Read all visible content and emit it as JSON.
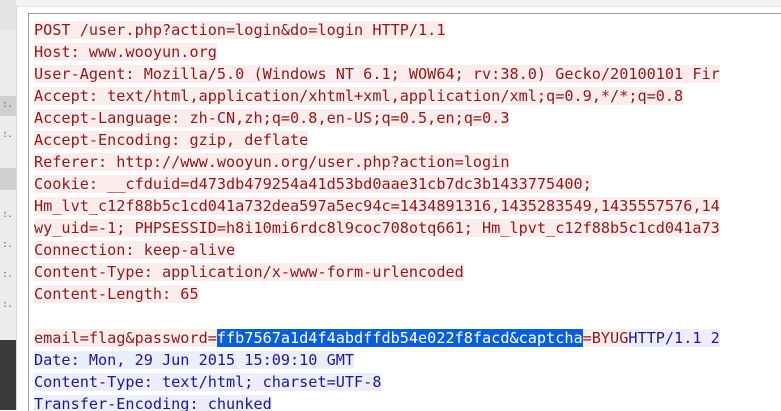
{
  "request": {
    "lines": [
      "POST /user.php?action=login&do=login HTTP/1.1",
      "Host: www.wooyun.org",
      "User-Agent: Mozilla/5.0 (Windows NT 6.1; WOW64; rv:38.0) Gecko/20100101 Fir",
      "Accept: text/html,application/xhtml+xml,application/xml;q=0.9,*/*;q=0.8",
      "Accept-Language: zh-CN,zh;q=0.8,en-US;q=0.5,en;q=0.3",
      "Accept-Encoding: gzip, deflate",
      "Referer: http://www.wooyun.org/user.php?action=login",
      "Cookie: __cfduid=d473db479254a41d53bd0aae31cb7dc3b1433775400;",
      "Hm_lvt_c12f88b5c1cd041a732dea597a5ec94c=1434891316,1435283549,1435557576,14",
      "wy_uid=-1; PHPSESSID=h8i10mi6rdc8l9coc708otq661; Hm_lpvt_c12f88b5c1cd041a73",
      "Connection: keep-alive",
      "Content-Type: application/x-www-form-urlencoded",
      "Content-Length: 65"
    ],
    "body_before": "email=flag&password=",
    "body_selected": "ffb7567a1d4f4abdffdb54e022f8facd&captcha",
    "body_after": "=BYUG"
  },
  "response": {
    "first_line_tail": "HTTP/1.1 2",
    "lines": [
      "Date: Mon, 29 Jun 2015 15:09:10 GMT",
      "Content-Type: text/html; charset=UTF-8",
      "Transfer-Encoding: chunked"
    ]
  },
  "colors": {
    "request_text": "#8b1a1a",
    "request_bg": "#fbeded",
    "response_text": "#1a1a8b",
    "response_bg": "#ededfb",
    "selection": "#0a5fd6"
  }
}
